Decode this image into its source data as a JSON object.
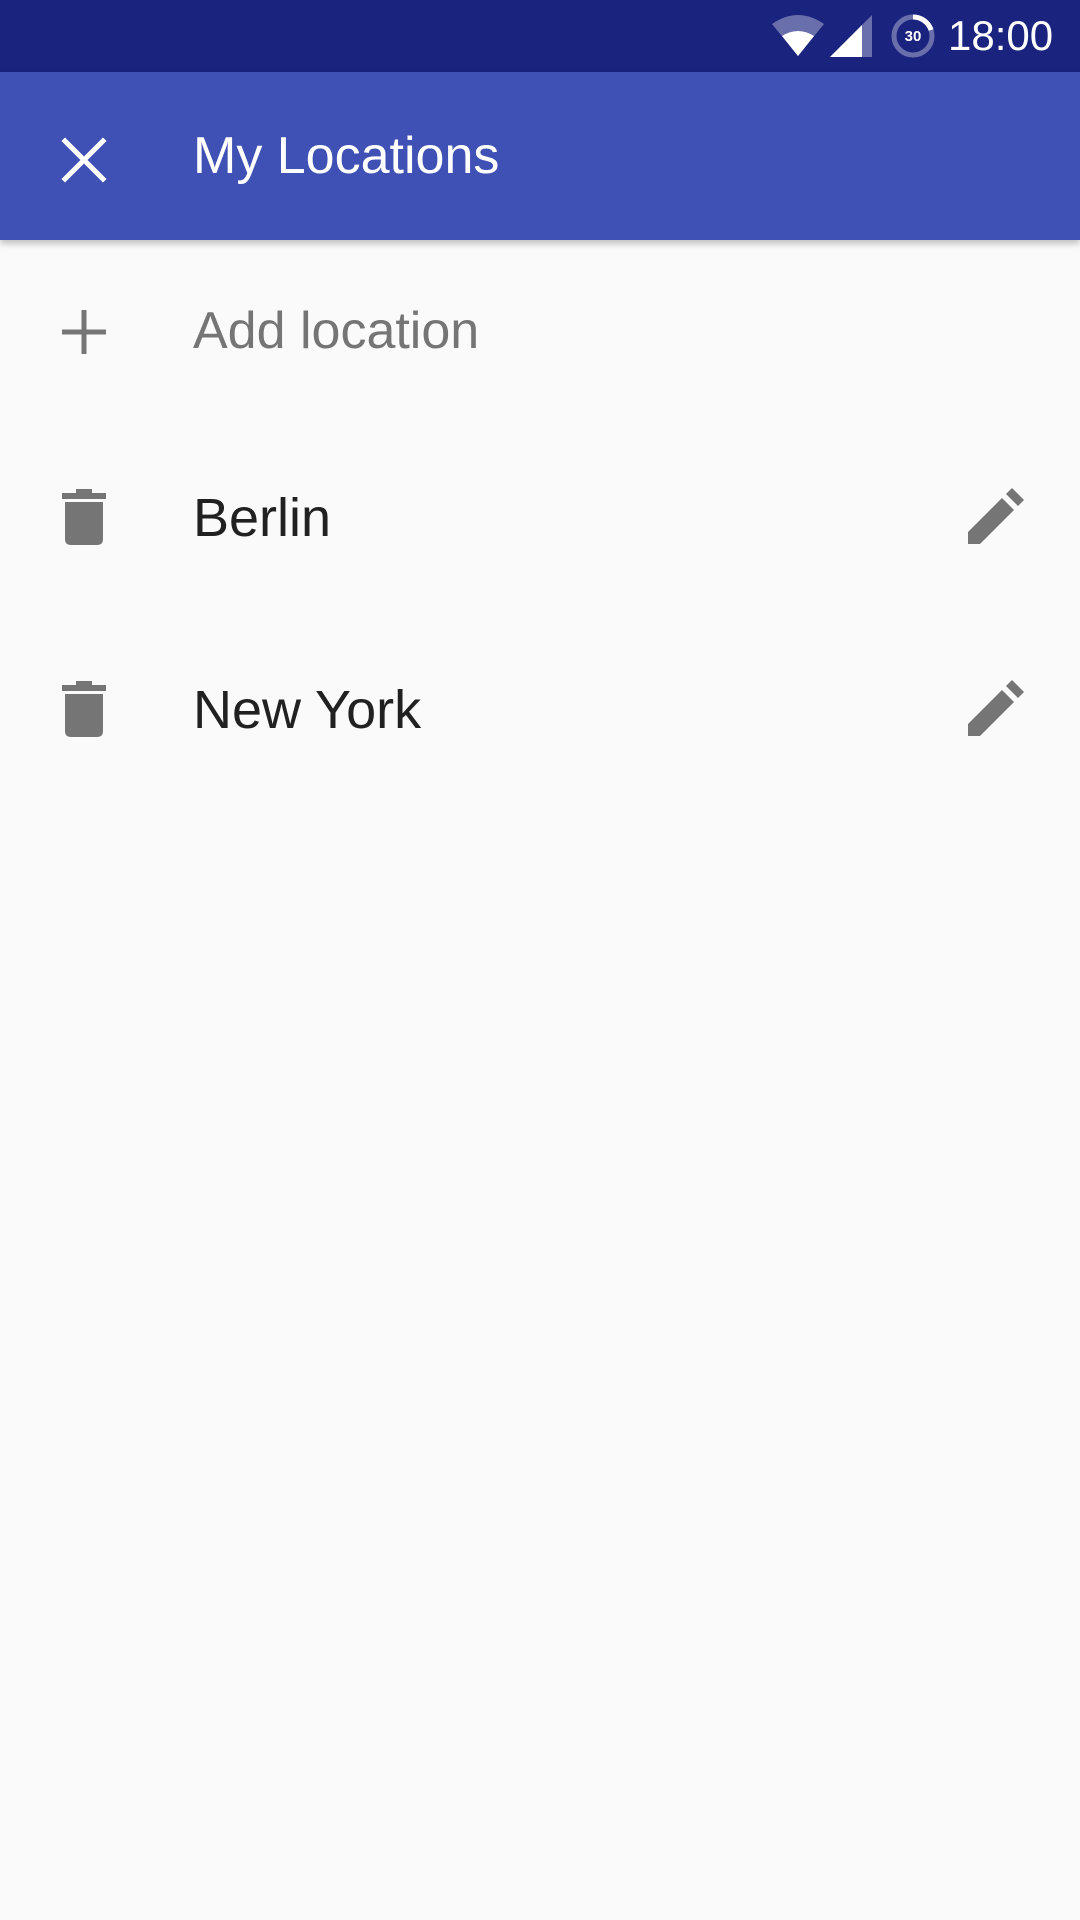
{
  "status_bar": {
    "time": "18:00",
    "battery_level": "30",
    "icons": [
      "wifi-icon",
      "cell-signal-icon",
      "battery-saver-icon"
    ]
  },
  "app_bar": {
    "title": "My Locations",
    "close_icon": "close-icon"
  },
  "add_row": {
    "label": "Add location",
    "icon": "plus-icon"
  },
  "locations": [
    {
      "name": "Berlin",
      "delete_icon": "trash-icon",
      "edit_icon": "pencil-icon"
    },
    {
      "name": "New York",
      "delete_icon": "trash-icon",
      "edit_icon": "pencil-icon"
    }
  ],
  "colors": {
    "status_bar": "#1A237E",
    "app_bar": "#3F51B5",
    "background": "#FAFAFA",
    "icon_gray": "#757575",
    "text_primary": "#212121",
    "text_secondary": "#757575"
  }
}
